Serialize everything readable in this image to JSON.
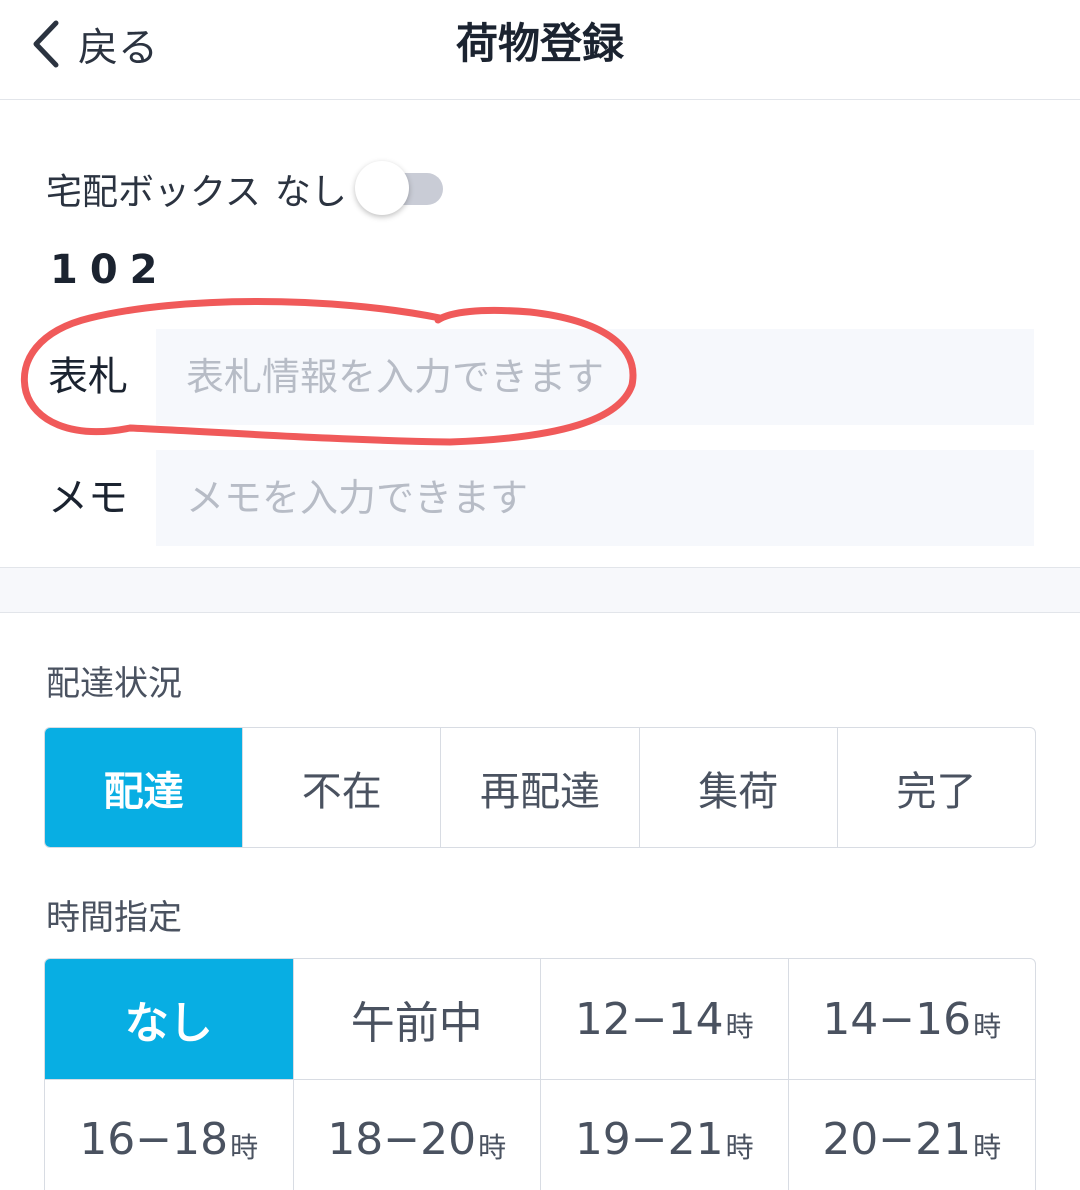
{
  "header": {
    "back_label": "戻る",
    "title": "荷物登録"
  },
  "delivery_box": {
    "label": "宅配ボックス",
    "status": "なし",
    "enabled": false
  },
  "room_number": "102",
  "nameplate": {
    "label": "表札",
    "placeholder": "表札情報を入力できます",
    "value": ""
  },
  "memo": {
    "label": "メモ",
    "placeholder": "メモを入力できます",
    "value": ""
  },
  "delivery_status": {
    "label": "配達状況",
    "options": [
      "配達",
      "不在",
      "再配達",
      "集荷",
      "完了"
    ],
    "selected": "配達"
  },
  "time_slot": {
    "label": "時間指定",
    "selected": "なし",
    "options": [
      {
        "main": "なし",
        "unit": ""
      },
      {
        "main": "午前中",
        "unit": ""
      },
      {
        "main": "12−14",
        "unit": "時"
      },
      {
        "main": "14−16",
        "unit": "時"
      },
      {
        "main": "16−18",
        "unit": "時"
      },
      {
        "main": "18−20",
        "unit": "時"
      },
      {
        "main": "19−21",
        "unit": "時"
      },
      {
        "main": "20−21",
        "unit": "時"
      }
    ]
  },
  "colors": {
    "accent": "#08aee3",
    "annotation": "#f05a5a"
  }
}
